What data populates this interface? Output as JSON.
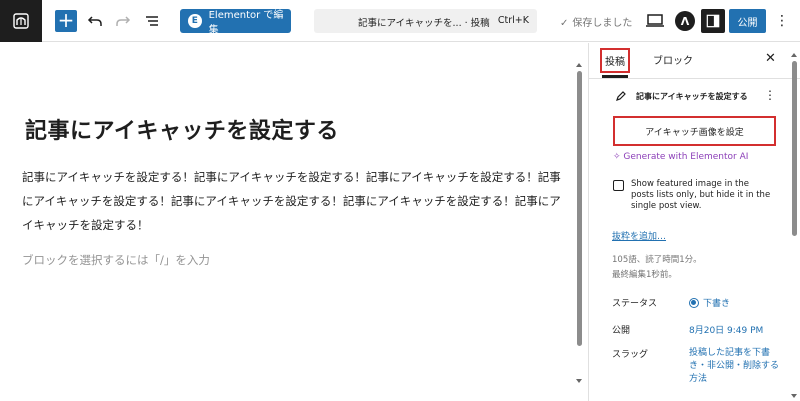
{
  "toolbar": {
    "add_label": "+",
    "elementor_icon": "E",
    "elementor_label": "Elementor で編集",
    "command_title": "記事にアイキャッチを... · 投稿",
    "command_shortcut": "Ctrl+K",
    "saved_check": "✓",
    "saved_label": "保存しました",
    "astra_icon": "Λ",
    "publish_label": "公開",
    "more_icon": "⋮"
  },
  "editor": {
    "title": "記事にアイキャッチを設定する",
    "paragraph": "記事にアイキャッチを設定する！記事にアイキャッチを設定する！記事にアイキャッチを設定する！記事にアイキャッチを設定する！記事にアイキャッチを設定する！記事にアイキャッチを設定する！記事にアイキャッチを設定する！",
    "placeholder": "ブロックを選択するには「/」を入力"
  },
  "sidebar": {
    "tab_post": "投稿",
    "tab_block": "ブロック",
    "close_icon": "✕",
    "post_card_title": "記事にアイキャッチを設定する",
    "post_card_more": "⋮",
    "featured_image_button": "アイキャッチ画像を設定",
    "generate_ai": "Generate with Elementor AI",
    "checkbox_label": "Show featured image in the posts lists only, but hide it in the single post view.",
    "excerpt_link": "抜粋を追加…",
    "word_count": "105語、読了時間1分。",
    "last_edited": "最終編集1秒前。",
    "status_label": "ステータス",
    "status_value": "下書き",
    "publish_label": "公開",
    "publish_value": "8月20日 9:49 PM",
    "slug_label": "スラッグ",
    "slug_value": "投稿した記事を下書き・非公開・削除する方法"
  },
  "colors": {
    "accent": "#2271b1",
    "highlight_border": "#d32f2f",
    "ai_purple": "#8c3fb8"
  }
}
